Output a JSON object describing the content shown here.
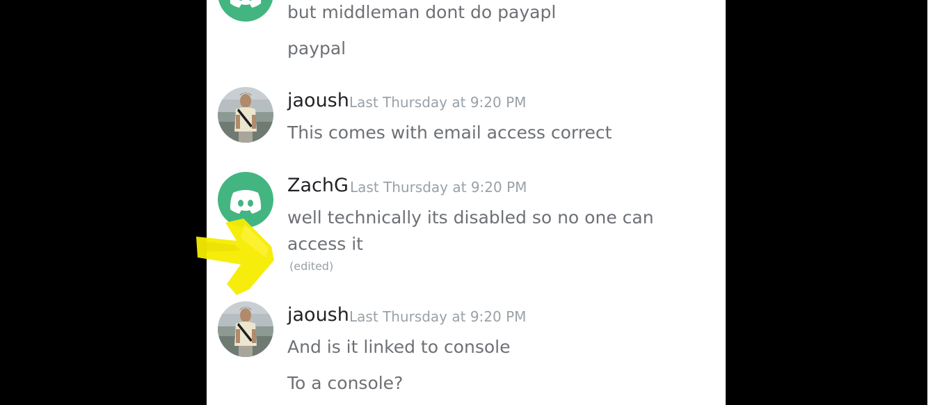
{
  "messages_top": {
    "line1": "but middleman dont do payapl",
    "line2": "paypal"
  },
  "msg1": {
    "user": "jaoush",
    "time": "Last Thursday at 9:20 PM",
    "text": "This comes with email access correct"
  },
  "msg2": {
    "user": "ZachG",
    "time": "Last Thursday at 9:20 PM",
    "text_line1": "well technically its disabled so no one can",
    "text_line2": "access it",
    "edited": "(edited)"
  },
  "msg3": {
    "user": "jaoush",
    "time": "Last Thursday at 9:20 PM",
    "text": "And is it linked to console",
    "text2": "To a console?"
  },
  "colors": {
    "discord_avatar": "#43b581",
    "username": "#1f2124",
    "timestamp": "#99a1a7",
    "message": "#6d7075",
    "highlight": "#f5ec00"
  },
  "icons": [
    "discord-logo-icon",
    "user-photo-avatar",
    "yellow-arrow-annotation"
  ]
}
